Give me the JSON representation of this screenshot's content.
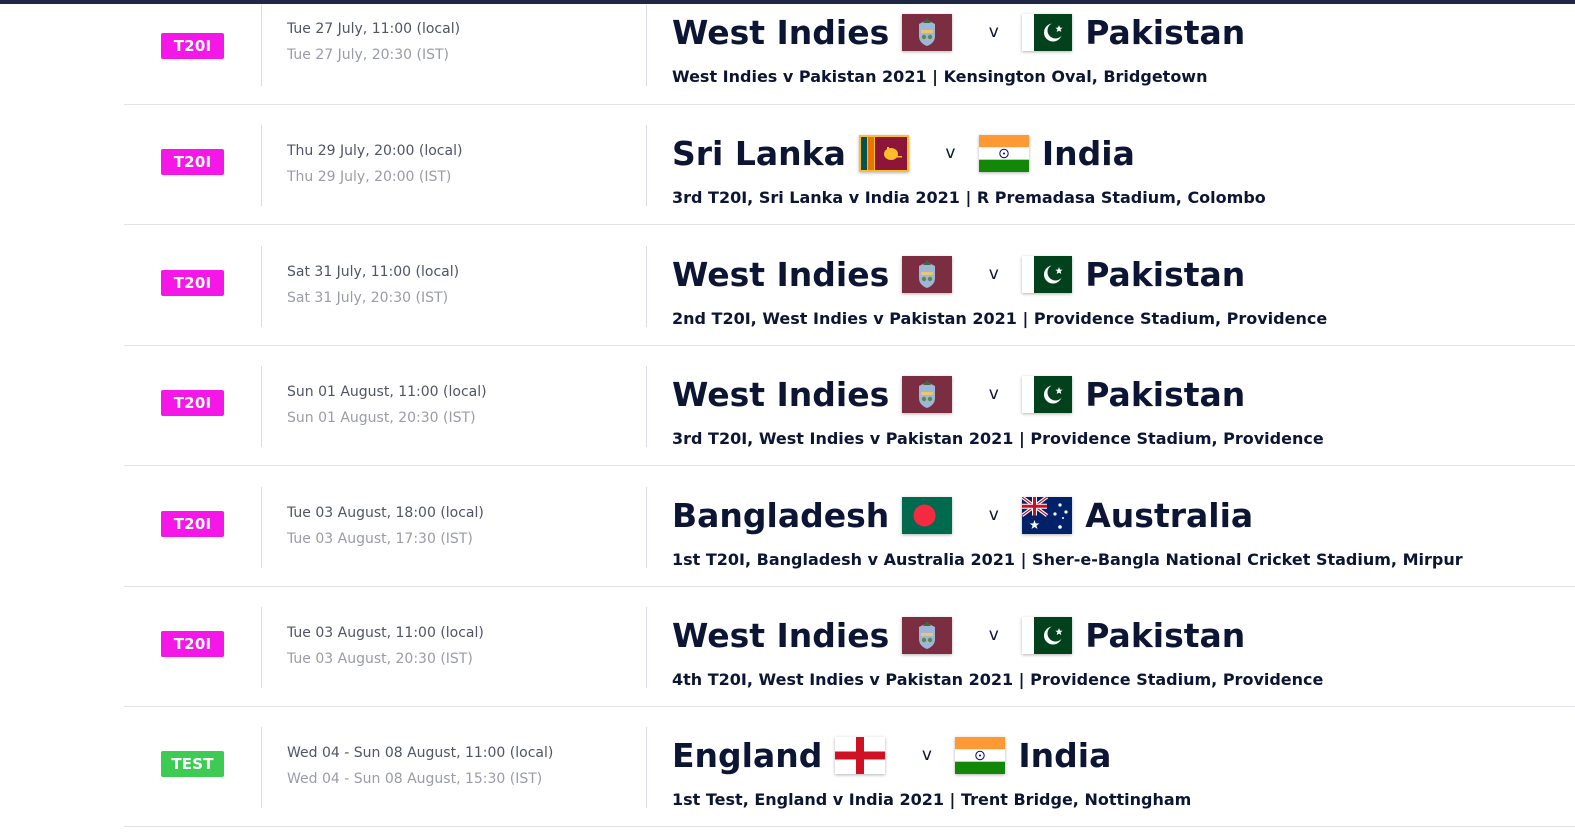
{
  "colors": {
    "t20i_badge": "#f516e8",
    "test_badge": "#3ecb53",
    "text_dark": "#0c1533"
  },
  "fixtures": [
    {
      "format": "T20I",
      "local_time": "Tue 27 July, 11:00 (local)",
      "ist_time": "Tue 27 July, 20:30 (IST)",
      "home": {
        "name": "West Indies",
        "flag": "west-indies-flag"
      },
      "vs": "v",
      "away": {
        "name": "Pakistan",
        "flag": "pakistan-flag"
      },
      "series": "West Indies v Pakistan 2021 | Kensington Oval, Bridgetown"
    },
    {
      "format": "T20I",
      "local_time": "Thu 29 July, 20:00 (local)",
      "ist_time": "Thu 29 July, 20:00 (IST)",
      "home": {
        "name": "Sri Lanka",
        "flag": "sri-lanka-flag"
      },
      "vs": "v",
      "away": {
        "name": "India",
        "flag": "india-flag"
      },
      "series": "3rd T20I, Sri Lanka v India 2021 | R Premadasa Stadium, Colombo"
    },
    {
      "format": "T20I",
      "local_time": "Sat 31 July, 11:00 (local)",
      "ist_time": "Sat 31 July, 20:30 (IST)",
      "home": {
        "name": "West Indies",
        "flag": "west-indies-flag"
      },
      "vs": "v",
      "away": {
        "name": "Pakistan",
        "flag": "pakistan-flag"
      },
      "series": "2nd T20I, West Indies v Pakistan 2021 | Providence Stadium, Providence"
    },
    {
      "format": "T20I",
      "local_time": "Sun 01 August, 11:00 (local)",
      "ist_time": "Sun 01 August, 20:30 (IST)",
      "home": {
        "name": "West Indies",
        "flag": "west-indies-flag"
      },
      "vs": "v",
      "away": {
        "name": "Pakistan",
        "flag": "pakistan-flag"
      },
      "series": "3rd T20I, West Indies v Pakistan 2021 | Providence Stadium, Providence"
    },
    {
      "format": "T20I",
      "local_time": "Tue 03 August, 18:00 (local)",
      "ist_time": "Tue 03 August, 17:30 (IST)",
      "home": {
        "name": "Bangladesh",
        "flag": "bangladesh-flag"
      },
      "vs": "v",
      "away": {
        "name": "Australia",
        "flag": "australia-flag"
      },
      "series": "1st T20I, Bangladesh v Australia 2021 | Sher-e-Bangla National Cricket Stadium, Mirpur"
    },
    {
      "format": "T20I",
      "local_time": "Tue 03 August, 11:00 (local)",
      "ist_time": "Tue 03 August, 20:30 (IST)",
      "home": {
        "name": "West Indies",
        "flag": "west-indies-flag"
      },
      "vs": "v",
      "away": {
        "name": "Pakistan",
        "flag": "pakistan-flag"
      },
      "series": "4th T20I, West Indies v Pakistan 2021 | Providence Stadium, Providence"
    },
    {
      "format": "TEST",
      "local_time": "Wed 04 - Sun 08 August, 11:00 (local)",
      "ist_time": "Wed 04 - Sun 08 August, 15:30 (IST)",
      "home": {
        "name": "England",
        "flag": "england-flag"
      },
      "vs": "v",
      "away": {
        "name": "India",
        "flag": "india-flag"
      },
      "series": "1st Test, England v India 2021 | Trent Bridge, Nottingham"
    }
  ]
}
